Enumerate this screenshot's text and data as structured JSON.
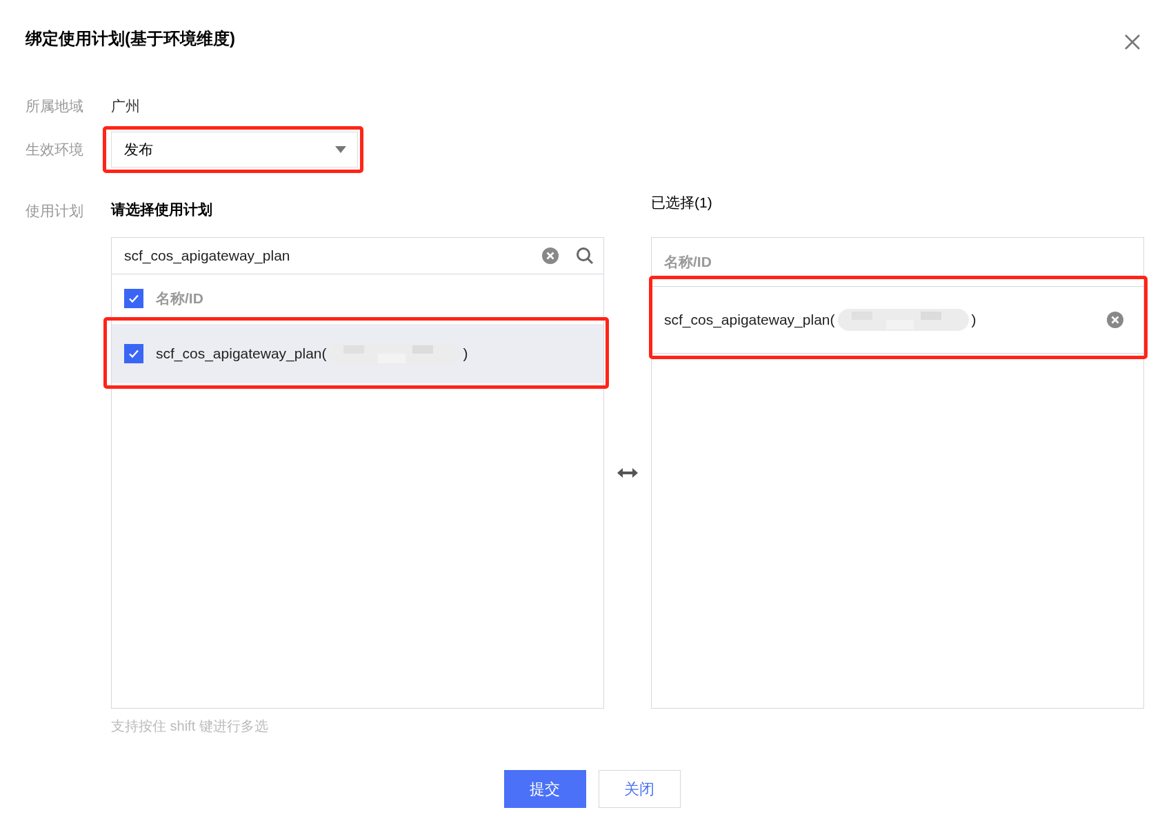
{
  "dialog": {
    "title": "绑定使用计划(基于环境维度)"
  },
  "region": {
    "label": "所属地域",
    "value": "广州"
  },
  "environment": {
    "label": "生效环境",
    "value": "发布",
    "highlighted": true
  },
  "plan": {
    "label": "使用计划",
    "heading": "请选择使用计划",
    "selected_heading": "已选择(1)",
    "search": {
      "value": "scf_cos_apigateway_plan"
    },
    "source": {
      "column": "名称/ID",
      "all_checked": true,
      "items": [
        {
          "name": "scf_cos_apigateway_plan(",
          "suffix": ")",
          "checked": true,
          "redacted": true,
          "highlighted": true
        }
      ]
    },
    "target": {
      "column": "名称/ID",
      "items": [
        {
          "name": "scf_cos_apigateway_plan(",
          "suffix": ")",
          "redacted": true,
          "highlighted": true
        }
      ]
    },
    "hint": "支持按住 shift 键进行多选"
  },
  "buttons": [
    {
      "label": "提交",
      "kind": "primary"
    },
    {
      "label": "关闭",
      "kind": "secondary"
    }
  ]
}
